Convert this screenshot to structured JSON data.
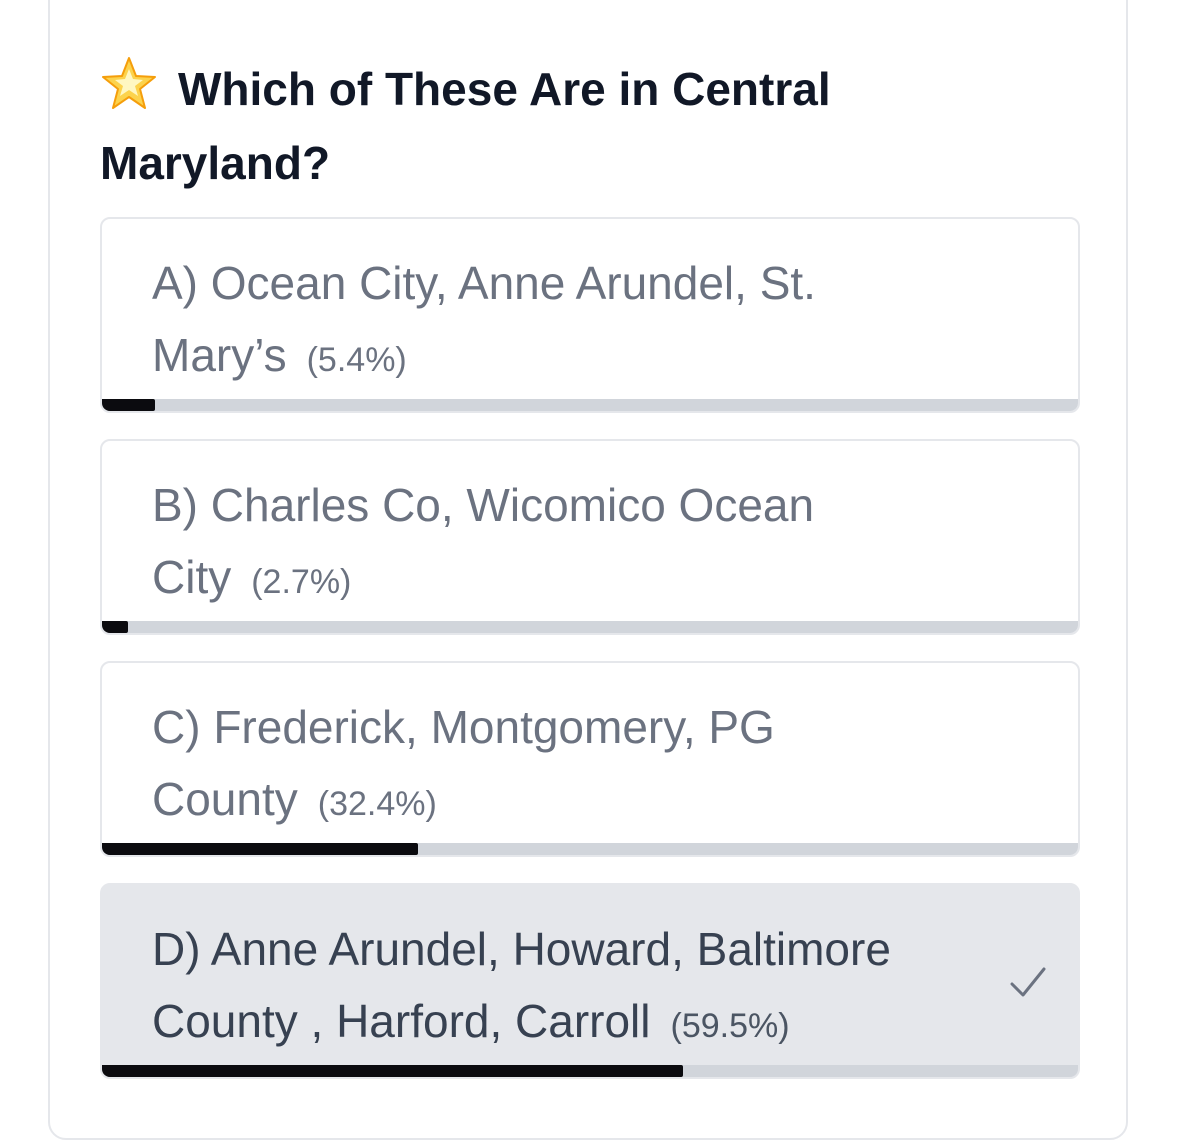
{
  "poll": {
    "title": "Which of These Are in Central Maryland?",
    "title_icon": "star-icon",
    "options": [
      {
        "label": "A) Ocean City, Anne Arundel, St. Mary’s",
        "percent_text": "(5.4%)",
        "percent": 5.4,
        "selected": false
      },
      {
        "label": "B) Charles Co, Wicomico Ocean City",
        "percent_text": "(2.7%)",
        "percent": 2.7,
        "selected": false
      },
      {
        "label": "C) Frederick, Montgomery, PG County",
        "percent_text": "(32.4%)",
        "percent": 32.4,
        "selected": false
      },
      {
        "label": "D) Anne Arundel, Howard, Baltimore County , Harford, Carroll",
        "percent_text": "(59.5%)",
        "percent": 59.5,
        "selected": true,
        "selected_icon": "checkmark-icon"
      }
    ],
    "colors": {
      "bar_fill": "#0b0b0f",
      "bar_track": "#d1d5db",
      "selected_bg": "#e5e7eb"
    }
  }
}
